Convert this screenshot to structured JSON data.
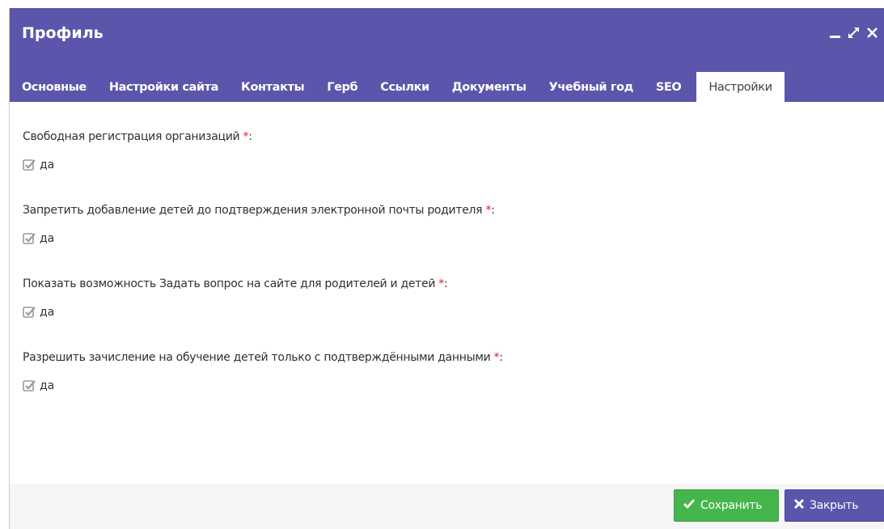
{
  "window": {
    "title": "Профиль",
    "controls": [
      "minimize-icon",
      "maximize-icon",
      "close-icon"
    ]
  },
  "tabs": [
    {
      "label": "Основные"
    },
    {
      "label": "Настройки сайта"
    },
    {
      "label": "Контакты"
    },
    {
      "label": "Герб"
    },
    {
      "label": "Ссылки"
    },
    {
      "label": "Документы"
    },
    {
      "label": "Учебный год"
    },
    {
      "label": "SEO"
    },
    {
      "label": "Настройки",
      "active": true
    }
  ],
  "fields": [
    {
      "label": "Свободная регистрация организаций",
      "required_mark": "*",
      "suffix": ":",
      "checkbox_label": "да",
      "checked": true
    },
    {
      "label": "Запретить добавление детей до подтверждения электронной почты родителя",
      "required_mark": "*",
      "suffix": ":",
      "checkbox_label": "да",
      "checked": true
    },
    {
      "label": "Показать возможность Задать вопрос на сайте для родителей и детей",
      "required_mark": "*",
      "suffix": ":",
      "checkbox_label": "да",
      "checked": true
    },
    {
      "label": "Разрешить зачисление на обучение детей только с подтверждёнными данными",
      "required_mark": "*",
      "suffix": ":",
      "checkbox_label": "да",
      "checked": true
    }
  ],
  "footer": {
    "save_label": "Сохранить",
    "close_label": "Закрыть"
  },
  "colors": {
    "accent": "#5b56ab",
    "save": "#45b64c",
    "required": "#e02020"
  }
}
